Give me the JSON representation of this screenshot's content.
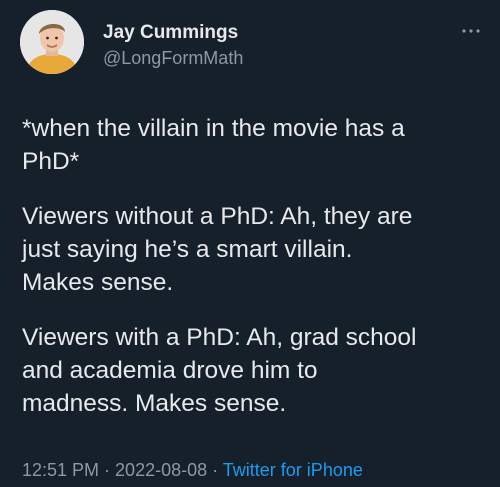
{
  "author": {
    "name": "Jay Cummings",
    "handle": "@LongFormMath",
    "avatar_icon": "profile-photo"
  },
  "more_icon": "more-options-icon",
  "tweet": {
    "paragraphs": [
      "*when the villain in the movie has a\nPhD*",
      "Viewers without a PhD: Ah, they are\njust saying he’s a smart villain.\nMakes sense.",
      "Viewers with a PhD: Ah, grad school\nand academia drove him to\nmadness. Makes sense."
    ],
    "time": "12:51 PM",
    "separator1": " · ",
    "date": "2022-08-08",
    "separator2": " · ",
    "source": "Twitter for iPhone"
  },
  "colors": {
    "background": "#15202b",
    "text": "#e7e9ea",
    "muted": "#8b98a5",
    "link": "#1d9bf0"
  }
}
